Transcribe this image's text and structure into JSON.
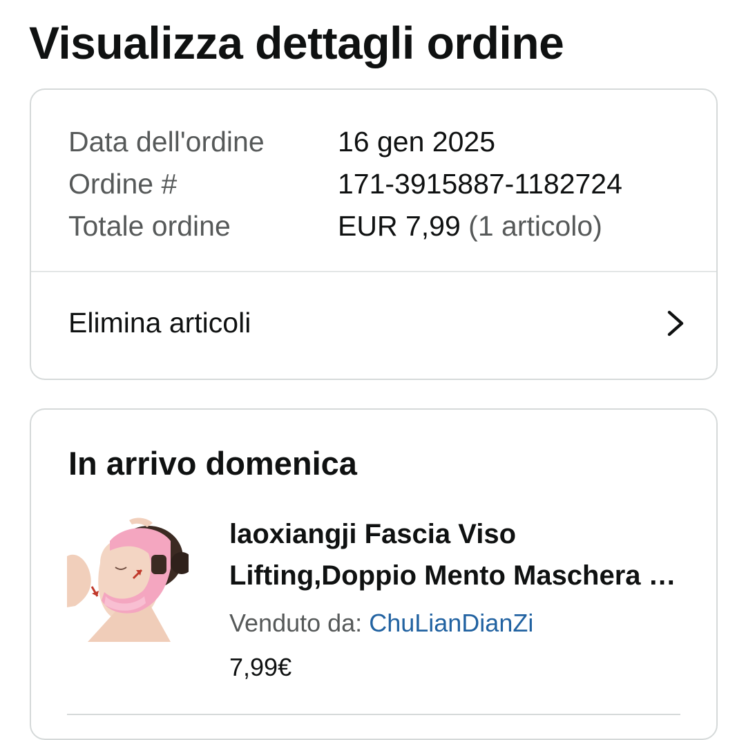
{
  "header": {
    "title": "Visualizza dettagli ordine"
  },
  "summary": {
    "rows": [
      {
        "label": "Data dell'ordine",
        "value": "16 gen 2025",
        "note": ""
      },
      {
        "label": "Ordine #",
        "value": "171-3915887-1182724",
        "note": ""
      },
      {
        "label": "Totale ordine",
        "value": "EUR 7,99",
        "note": "(1 articolo)"
      }
    ],
    "action_label": "Elimina articoli",
    "action_icon": "chevron-right-icon"
  },
  "shipment": {
    "title": "In arrivo domenica",
    "product": {
      "title_line1": "laoxiangji Fascia Viso",
      "title_line2": "Lifting,Doppio Mento Maschera Viso",
      "seller_prefix": "Venduto da:",
      "seller_name": "ChuLianDianZi",
      "price": "7,99€",
      "image_icon": "product-photo-face-strap"
    }
  },
  "colors": {
    "text_primary": "#0f1111",
    "text_secondary": "#565959",
    "link": "#2162a1",
    "border": "#d5d9d9",
    "product_pink": "#f4a6c0"
  }
}
